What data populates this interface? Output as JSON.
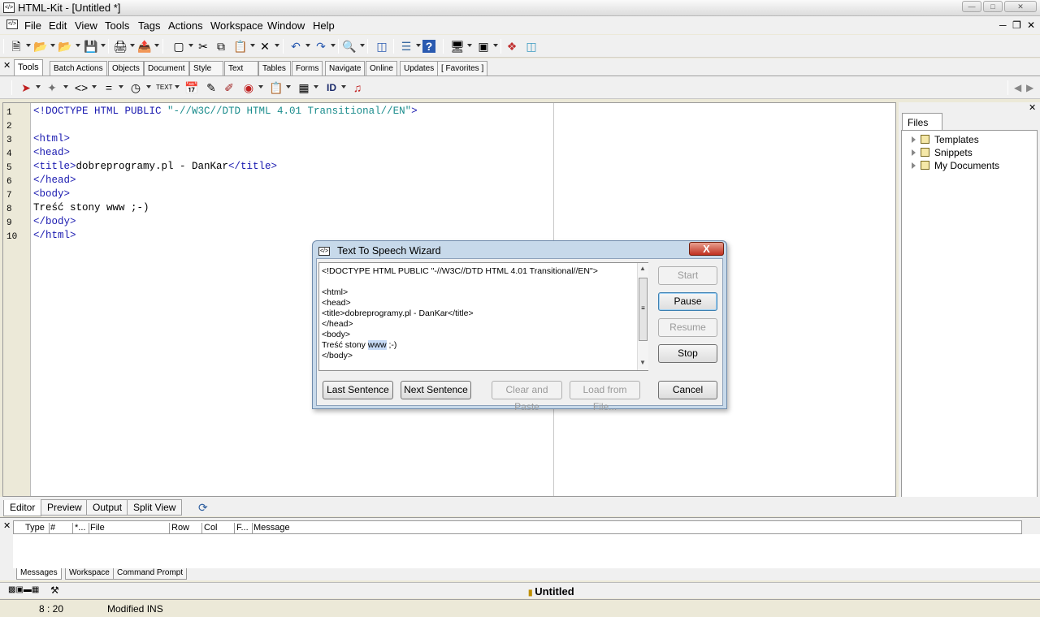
{
  "window": {
    "title": "HTML-Kit - [Untitled *]",
    "app_icon": "htmlkit-icon"
  },
  "menu": [
    "File",
    "Edit",
    "View",
    "Tools",
    "Tags",
    "Actions",
    "Workspace",
    "Window",
    "Help"
  ],
  "toolbar_tabs": [
    "Tools",
    "Batch Actions",
    "Objects",
    "Document",
    "Style",
    "Text",
    "Tables",
    "Forms",
    "Navigate",
    "Online",
    "Updates",
    "[ Favorites ]"
  ],
  "editor": {
    "line_numbers": [
      "1",
      "2",
      "3",
      "4",
      "5",
      "6",
      "7",
      "8",
      "9",
      "10"
    ],
    "lines": [
      {
        "tag": "<!DOCTYPE HTML PUBLIC ",
        "str": "\"-//W3C//DTD HTML 4.01 Transitional//EN\"",
        "tail": ">"
      },
      {
        "tag": "",
        "str": "",
        "tail": ""
      },
      {
        "tag": "<html>",
        "str": "",
        "tail": ""
      },
      {
        "tag": "<head>",
        "str": "",
        "tail": ""
      },
      {
        "tag": "<title>",
        "text": "dobreprogramy.pl - DanKar",
        "tag2": "</title>"
      },
      {
        "tag": "</head>",
        "str": "",
        "tail": ""
      },
      {
        "tag": "<body>",
        "str": "",
        "tail": ""
      },
      {
        "text": "Treść stony www ;-)"
      },
      {
        "tag": "</body>",
        "str": "",
        "tail": ""
      },
      {
        "tag": "</html>",
        "str": "",
        "tail": ""
      }
    ]
  },
  "files_panel": {
    "tab": "Files",
    "items": [
      "Templates",
      "Snippets",
      "My Documents"
    ]
  },
  "view_tabs": [
    "Editor",
    "Preview",
    "Output",
    "Split View"
  ],
  "messages": {
    "columns": [
      "Type",
      "#",
      "*...",
      "File",
      "Row",
      "Col",
      "F...",
      "Message"
    ],
    "tabs": [
      "Messages",
      "Workspace",
      "Command Prompt"
    ]
  },
  "doc_bar": {
    "title": "Untitled"
  },
  "status": {
    "position": "8 : 20",
    "mode": "Modified INS"
  },
  "dialog": {
    "title": "Text To Speech Wizard",
    "close": "X",
    "text_lines": [
      "<!DOCTYPE HTML PUBLIC \"-//W3C//DTD HTML 4.01 Transitional//EN\">",
      "",
      "<html>",
      "<head>",
      "<title>dobreprogramy.pl - DanKar</title>",
      "</head>",
      "<body>",
      "Treść stony ",
      "</body>"
    ],
    "highlight": "www",
    "after_highlight": " ;-)",
    "buttons": {
      "start": "Start",
      "pause": "Pause",
      "resume": "Resume",
      "stop": "Stop",
      "last": "Last Sentence",
      "next": "Next Sentence",
      "clear": "Clear and Paste",
      "load": "Load from File...",
      "cancel": "Cancel"
    }
  }
}
